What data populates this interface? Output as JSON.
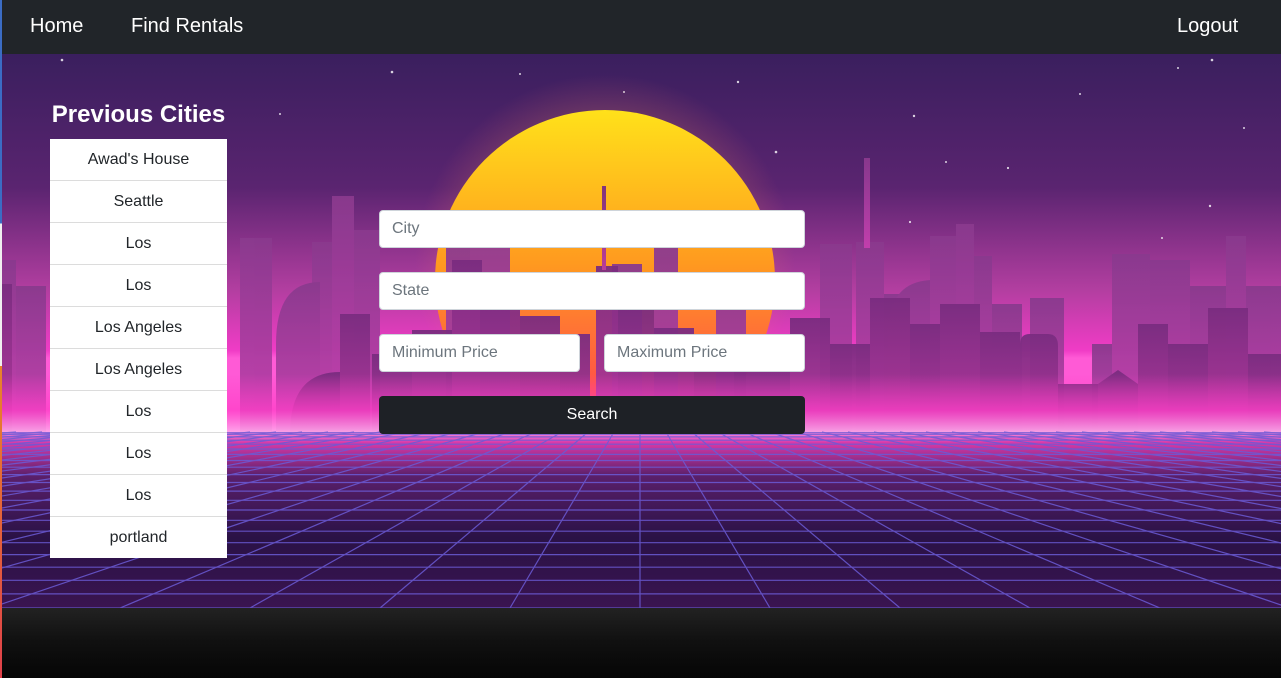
{
  "navbar": {
    "home_label": "Home",
    "find_rentals_label": "Find Rentals",
    "logout_label": "Logout"
  },
  "previous_cities": {
    "title": "Previous Cities",
    "items": [
      "Awad's House",
      "Seattle",
      "Los",
      "Los",
      "Los Angeles",
      "Los Angeles",
      "Los",
      "Los",
      "Los",
      "portland"
    ]
  },
  "search_form": {
    "city_placeholder": "City",
    "state_placeholder": "State",
    "min_price_placeholder": "Minimum Price",
    "max_price_placeholder": "Maximum Price",
    "search_label": "Search"
  },
  "colors": {
    "navbar_bg": "#212529",
    "button_bg": "#1e2126",
    "sky_top": "#3a1f5e",
    "horizon_glow": "#ff3fc8",
    "grid_line": "#6b5bd6",
    "sun_top": "#ffe11a",
    "sun_bottom": "#ff2e5c"
  }
}
